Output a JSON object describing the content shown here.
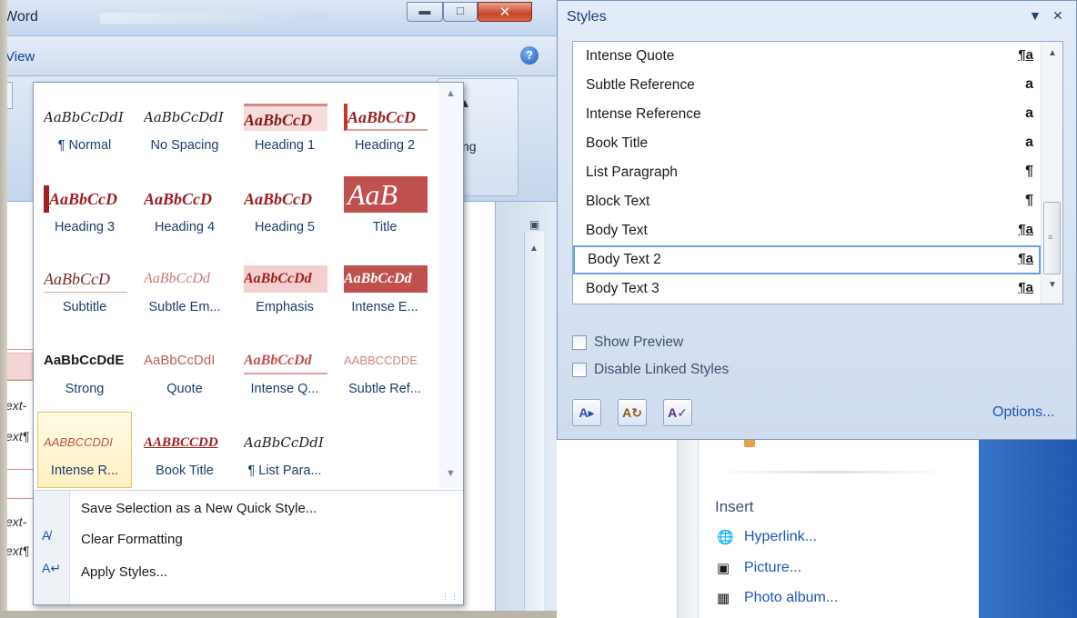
{
  "word": {
    "title": "Word",
    "tab_label": "View",
    "ribbon_right_label": "ting",
    "doc_fragments": [
      "ext-",
      "ext¶",
      "ext-",
      "ext¶"
    ]
  },
  "quick_styles": {
    "tiles": [
      {
        "preview": "AaBbCcDdI",
        "name": "¶ Normal"
      },
      {
        "preview": "AaBbCcDdI",
        "name": "No Spacing"
      },
      {
        "preview": "AaBbCcD",
        "name": "Heading 1"
      },
      {
        "preview": "AaBbCcD",
        "name": "Heading 2"
      },
      {
        "preview": "AaBbCcD",
        "name": "Heading 3"
      },
      {
        "preview": "AaBbCcD",
        "name": "Heading 4"
      },
      {
        "preview": "AaBbCcD",
        "name": "Heading 5"
      },
      {
        "preview": "AaB",
        "name": "Title"
      },
      {
        "preview": "AaBbCcD",
        "name": "Subtitle"
      },
      {
        "preview": "AaBbCcDd",
        "name": "Subtle Em..."
      },
      {
        "preview": "AaBbCcDd",
        "name": "Emphasis"
      },
      {
        "preview": "AaBbCcDd",
        "name": "Intense E..."
      },
      {
        "preview": "AaBbCcDdE",
        "name": "Strong"
      },
      {
        "preview": "AaBbCcDdI",
        "name": "Quote"
      },
      {
        "preview": "AaBbCcDd",
        "name": "Intense Q..."
      },
      {
        "preview": "AABBCCDDE",
        "name": "Subtle Ref..."
      },
      {
        "preview": "AABBCCDDI",
        "name": "Intense R..."
      },
      {
        "preview": "AABBCCDD",
        "name": "Book Title"
      },
      {
        "preview": "AaBbCcDdI",
        "name": "¶ List Para..."
      }
    ],
    "menu": {
      "save_selection": "Save Selection as a New Quick Style...",
      "clear_formatting": "Clear Formatting",
      "apply_styles": "Apply Styles..."
    }
  },
  "styles_pane": {
    "title": "Styles",
    "items": [
      {
        "name": "Intense Quote",
        "type": "¶a"
      },
      {
        "name": "Subtle Reference",
        "type": "a"
      },
      {
        "name": "Intense Reference",
        "type": "a"
      },
      {
        "name": "Book Title",
        "type": "a"
      },
      {
        "name": "List Paragraph",
        "type": "¶"
      },
      {
        "name": "Block Text",
        "type": "¶"
      },
      {
        "name": "Body Text",
        "type": "¶a"
      },
      {
        "name": "Body Text 2",
        "type": "¶a"
      },
      {
        "name": "Body Text 3",
        "type": "¶a"
      }
    ],
    "selected": "Body Text 2",
    "show_preview_label": "Show Preview",
    "disable_linked_label": "Disable Linked Styles",
    "options_label": "Options...",
    "accent": "#69a1e6"
  },
  "insert_section": {
    "heading": "Insert",
    "links": [
      "Hyperlink...",
      "Picture...",
      "Photo album..."
    ]
  }
}
